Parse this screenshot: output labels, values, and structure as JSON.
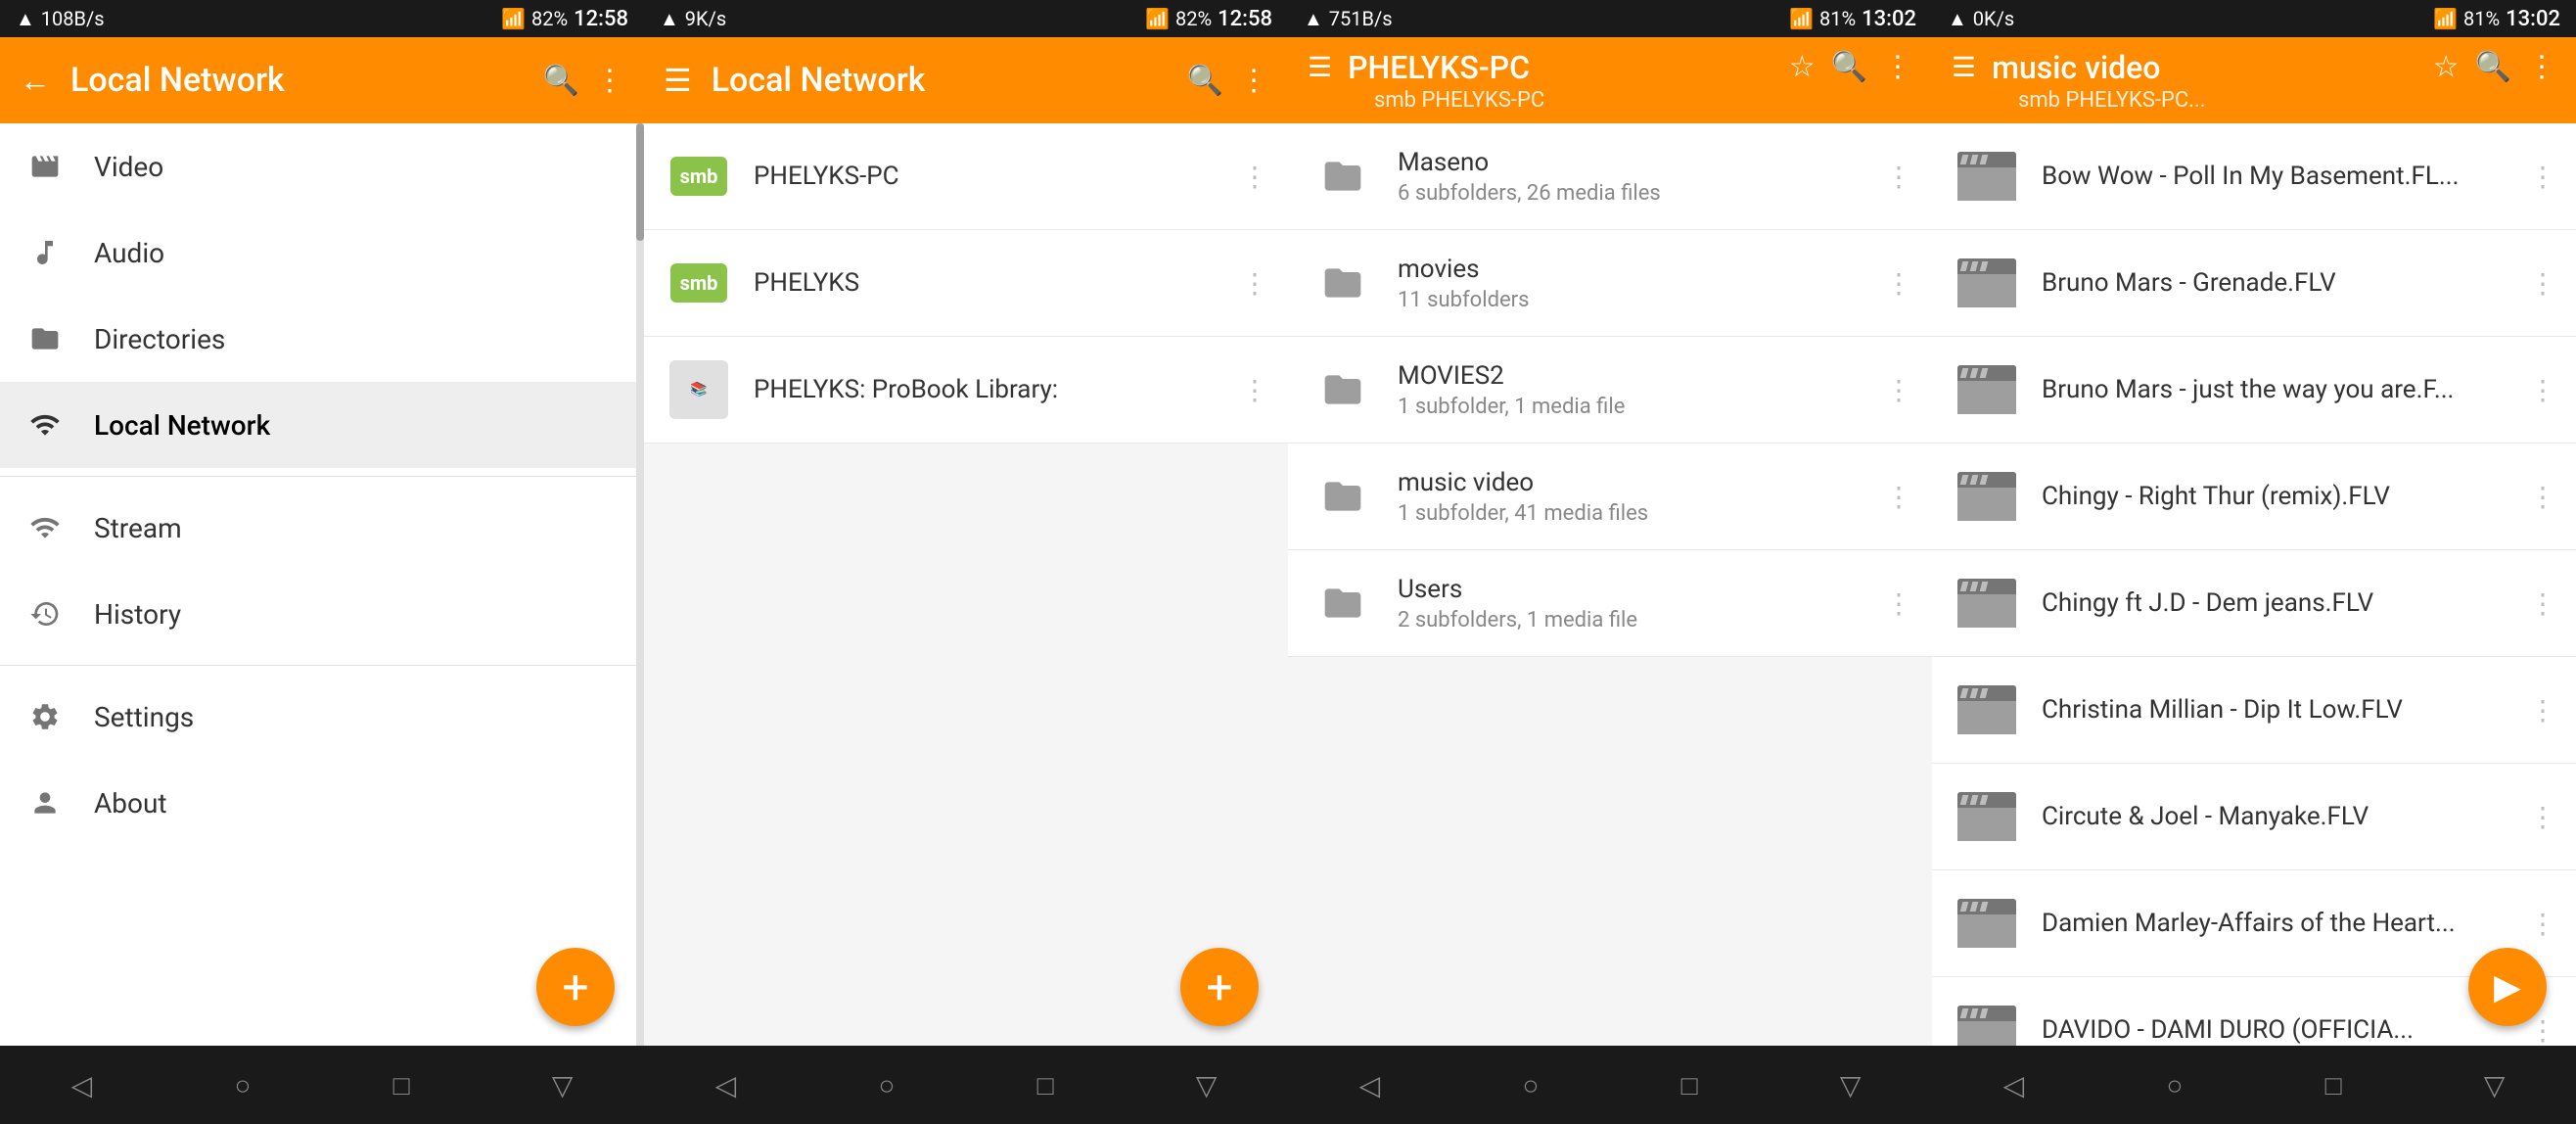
{
  "panels": [
    {
      "id": "panel1",
      "statusBar": {
        "speed": "108B/s",
        "time": "12:58",
        "battery": "82%"
      },
      "topBar": {
        "title": "Local Network",
        "hasBack": true,
        "hasSearch": true,
        "hasMore": true
      },
      "type": "sidebar",
      "menuItems": [
        {
          "id": "video",
          "label": "Video",
          "icon": "video"
        },
        {
          "id": "audio",
          "label": "Audio",
          "icon": "audio"
        },
        {
          "id": "directories",
          "label": "Directories",
          "icon": "folder"
        },
        {
          "id": "local-network",
          "label": "Local Network",
          "icon": "network",
          "active": true
        },
        {
          "id": "stream",
          "label": "Stream",
          "icon": "stream"
        },
        {
          "id": "history",
          "label": "History",
          "icon": "history"
        },
        {
          "id": "settings",
          "label": "Settings",
          "icon": "settings"
        },
        {
          "id": "about",
          "label": "About",
          "icon": "about"
        }
      ],
      "fab": "+"
    },
    {
      "id": "panel2",
      "statusBar": {
        "speed": "9K/s",
        "time": "12:58",
        "battery": "82%"
      },
      "topBar": {
        "title": "Local Network",
        "hasMenu": true,
        "hasSearch": true,
        "hasMore": true
      },
      "type": "list",
      "items": [
        {
          "id": "phelyks-pc",
          "badge": "smb",
          "name": "PHELYKS-PC",
          "sub": ""
        },
        {
          "id": "phelyks",
          "badge": "smb",
          "name": "PHELYKS",
          "sub": ""
        },
        {
          "id": "probook",
          "badge": "probook",
          "name": "PHELYKS: ProBook Library:",
          "sub": ""
        }
      ],
      "fab": "+"
    },
    {
      "id": "panel3",
      "statusBar": {
        "speed": "751B/s",
        "time": "13:02",
        "battery": "81%"
      },
      "topBar": {
        "title": "PHELYKS-PC",
        "subtitle": "smb PHELYKS-PC",
        "hasMenu": true,
        "hasStar": true,
        "hasSearch": true,
        "hasMore": true
      },
      "type": "folders",
      "items": [
        {
          "id": "maseno",
          "name": "Maseno",
          "sub": "6 subfolders, 26 media files"
        },
        {
          "id": "movies",
          "name": "movies",
          "sub": "11 subfolders"
        },
        {
          "id": "movies2",
          "name": "MOVIES2",
          "sub": "1 subfolder, 1 media file"
        },
        {
          "id": "music-video",
          "name": "music video",
          "sub": "1 subfolder, 41 media files"
        },
        {
          "id": "users",
          "name": "Users",
          "sub": "2 subfolders, 1 media file"
        }
      ]
    },
    {
      "id": "panel4",
      "statusBar": {
        "speed": "0K/s",
        "time": "13:02",
        "battery": "81%"
      },
      "topBar": {
        "title": "music video",
        "subtitle": "smb PHELYKS-PC...",
        "hasMenu": true,
        "hasStar": true,
        "hasSearch": true,
        "hasMore": true
      },
      "type": "files",
      "items": [
        {
          "id": "bow-wow",
          "name": "Bow Wow - Poll In  My Basement.FL..."
        },
        {
          "id": "bruno-grenade",
          "name": "Bruno Mars - Grenade.FLV"
        },
        {
          "id": "bruno-just",
          "name": "Bruno Mars - just the way you are.F..."
        },
        {
          "id": "chingy-right",
          "name": "Chingy - Right Thur (remix).FLV"
        },
        {
          "id": "chingy-dem",
          "name": "Chingy ft J.D - Dem jeans.FLV"
        },
        {
          "id": "christina",
          "name": "Christina Millian - Dip It Low.FLV"
        },
        {
          "id": "circute",
          "name": "Circute & Joel - Manyake.FLV"
        },
        {
          "id": "damien",
          "name": "Damien Marley-Affairs of the Heart..."
        },
        {
          "id": "davido",
          "name": "DAVIDO - DAMI DURO (OFFICIA..."
        }
      ],
      "playFab": "▶"
    }
  ]
}
